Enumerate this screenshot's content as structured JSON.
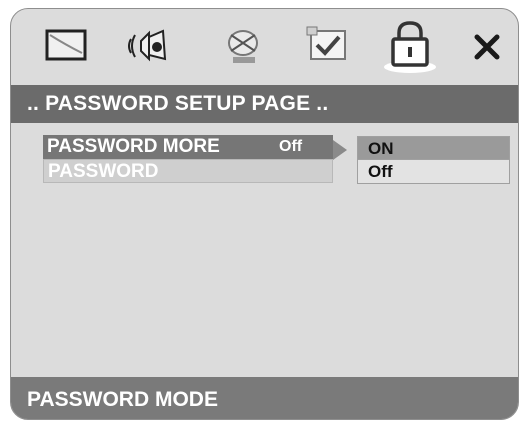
{
  "tabs": [
    {
      "icon": "monitor-icon"
    },
    {
      "icon": "speaker-icon"
    },
    {
      "icon": "dolby-icon"
    },
    {
      "icon": "preferences-icon"
    },
    {
      "icon": "lock-icon"
    },
    {
      "icon": "close-icon"
    }
  ],
  "title": ".. PASSWORD SETUP PAGE ..",
  "menu": {
    "items": [
      {
        "label": "PASSWORD MORE",
        "value": "Off"
      },
      {
        "label": "PASSWORD"
      }
    ]
  },
  "options": [
    "ON",
    "Off"
  ],
  "status": "PASSWORD MODE",
  "colors": {
    "panel": "#dcdcdc",
    "title_bar": "#6b6b6b",
    "selected_row": "#767676",
    "option_highlight": "#9a9a9a",
    "status_bar": "#7a7a7a"
  }
}
